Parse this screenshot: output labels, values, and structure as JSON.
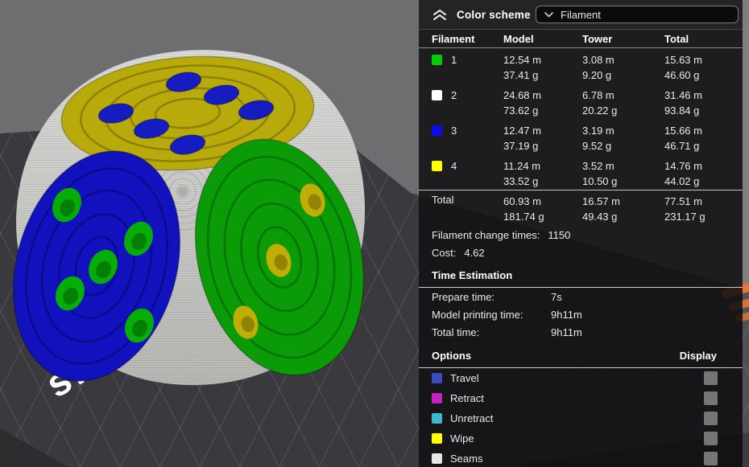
{
  "scene": {
    "background_color": "#6E6E71",
    "plate_color": "#3A3A3E",
    "plate_text": "sr",
    "logo_color": "#E0661A",
    "dice": {
      "top_face": {
        "color": "#B7AA0A",
        "pip_color": "#151CC0",
        "pips": 6
      },
      "left_face": {
        "color": "#1111BE",
        "pip_color": "#06AD06",
        "pips": 5
      },
      "right_face": {
        "color": "#0A9B07",
        "pip_color": "#BFAE06",
        "pips": 3
      }
    }
  },
  "panel": {
    "header": {
      "title": "Color scheme",
      "dropdown_value": "Filament"
    },
    "table": {
      "columns": [
        "Filament",
        "Model",
        "Tower",
        "Total"
      ],
      "rows": [
        {
          "id": "1",
          "color": "#00CC00",
          "model_m": "12.54 m",
          "model_g": "37.41 g",
          "tower_m": "3.08 m",
          "tower_g": "9.20 g",
          "total_m": "15.63 m",
          "total_g": "46.60 g"
        },
        {
          "id": "2",
          "color": "#FFFFFF",
          "model_m": "24.68 m",
          "model_g": "73.62 g",
          "tower_m": "6.78 m",
          "tower_g": "20.22 g",
          "total_m": "31.46 m",
          "total_g": "93.84 g"
        },
        {
          "id": "3",
          "color": "#0B0BEA",
          "model_m": "12.47 m",
          "model_g": "37.19 g",
          "tower_m": "3.19 m",
          "tower_g": "9.52 g",
          "total_m": "15.66 m",
          "total_g": "46.71 g"
        },
        {
          "id": "4",
          "color": "#FFFF00",
          "model_m": "11.24 m",
          "model_g": "33.52 g",
          "tower_m": "3.52 m",
          "tower_g": "10.50 g",
          "total_m": "14.76 m",
          "total_g": "44.02 g"
        }
      ],
      "total_row": {
        "label": "Total",
        "model_m": "60.93 m",
        "model_g": "181.74 g",
        "tower_m": "16.57 m",
        "tower_g": "49.43 g",
        "total_m": "77.51 m",
        "total_g": "231.17 g"
      }
    },
    "stats": [
      {
        "label": "Filament change times:",
        "value": "1150"
      },
      {
        "label": "Cost:",
        "value": "4.62"
      }
    ],
    "time_estimation": {
      "title": "Time Estimation",
      "rows": [
        {
          "label": "Prepare time:",
          "value": "7s"
        },
        {
          "label": "Model printing time:",
          "value": "9h11m"
        },
        {
          "label": "Total time:",
          "value": "9h11m"
        }
      ]
    },
    "options": {
      "title": "Options",
      "display_label": "Display",
      "items": [
        {
          "label": "Travel",
          "color": "#3C49C3",
          "checked": false
        },
        {
          "label": "Retract",
          "color": "#C521C5",
          "checked": false
        },
        {
          "label": "Unretract",
          "color": "#3FB9CE",
          "checked": false
        },
        {
          "label": "Wipe",
          "color": "#FFFF00",
          "checked": false
        },
        {
          "label": "Seams",
          "color": "#E6E6E6",
          "checked": false
        }
      ]
    }
  }
}
